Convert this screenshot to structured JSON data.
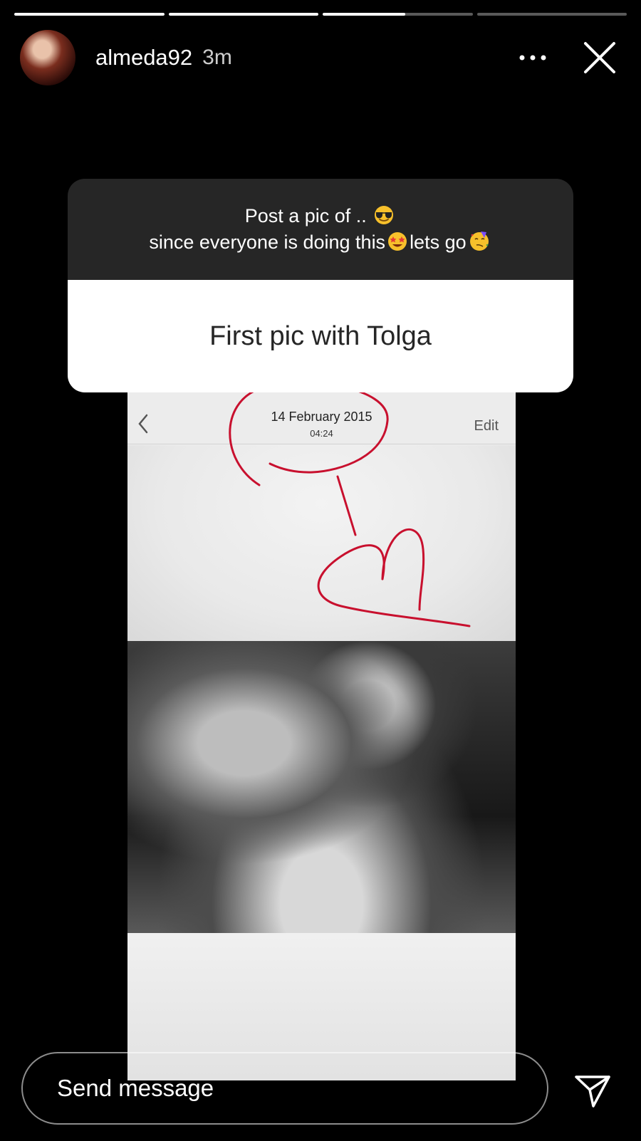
{
  "story": {
    "progress": [
      1,
      1,
      0.55,
      0
    ]
  },
  "header": {
    "username": "almeda92",
    "time": "3m",
    "more_icon": "more-horizontal-icon",
    "close_icon": "close-icon"
  },
  "sticker": {
    "question_line1": "Post a pic of ..",
    "question_line2_a": "since everyone is doing this",
    "question_line2_b": "lets go",
    "answer": "First pic with Tolga",
    "emojis": [
      "smiling-face-with-sunglasses",
      "star-struck",
      "partying-face"
    ],
    "top_color": "#262626",
    "answer_color": "#262626"
  },
  "photo": {
    "date": "14 February 2015",
    "time": "04:24",
    "edit_label": "Edit",
    "annotation_color": "#c8102e"
  },
  "footer": {
    "message_placeholder": "Send message",
    "send_icon": "send-icon"
  }
}
